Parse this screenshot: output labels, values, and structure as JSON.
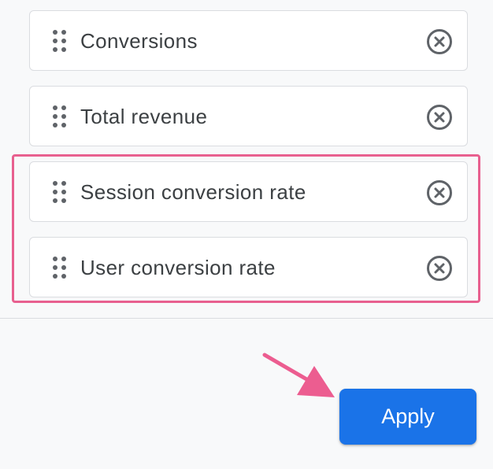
{
  "metrics": [
    {
      "label": "Conversions",
      "remove_icon": "close-circle-icon",
      "drag_icon": "drag-handle-icon"
    },
    {
      "label": "Total revenue",
      "remove_icon": "close-circle-icon",
      "drag_icon": "drag-handle-icon"
    },
    {
      "label": "Session conversion rate",
      "remove_icon": "close-circle-icon",
      "drag_icon": "drag-handle-icon"
    },
    {
      "label": "User conversion rate",
      "remove_icon": "close-circle-icon",
      "drag_icon": "drag-handle-icon"
    }
  ],
  "actions": {
    "apply_label": "Apply"
  },
  "colors": {
    "accent": "#1a73e8",
    "highlight": "#e8608f",
    "text": "#3c4043",
    "icon": "#5f6368",
    "border": "#dadce0",
    "background": "#f8f9fa"
  }
}
